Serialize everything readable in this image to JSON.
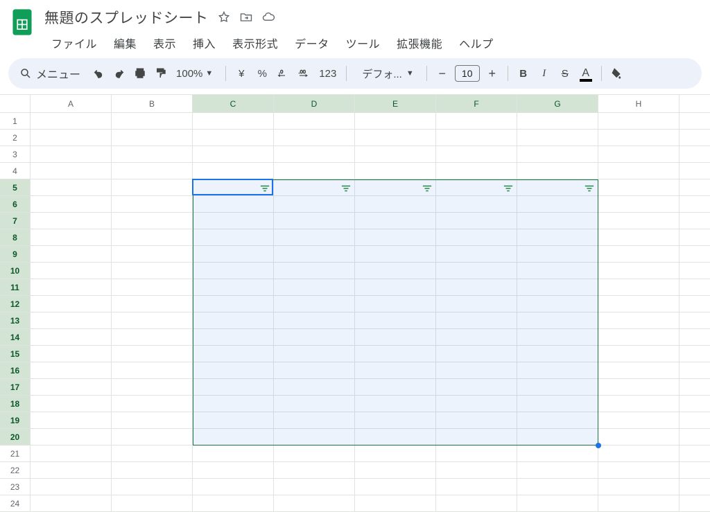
{
  "doc": {
    "title": "無題のスプレッドシート"
  },
  "menu": {
    "file": "ファイル",
    "edit": "編集",
    "view": "表示",
    "insert": "挿入",
    "format": "表示形式",
    "data": "データ",
    "tools": "ツール",
    "extensions": "拡張機能",
    "help": "ヘルプ"
  },
  "toolbar": {
    "menu_search": "メニュー",
    "zoom": "100%",
    "currency_symbol": "¥",
    "percent_symbol": "%",
    "decrease_dec": ".0",
    "increase_dec": ".00",
    "number_format": "123",
    "font_name": "デフォ...",
    "font_size": "10",
    "bold": "B",
    "italic": "I",
    "strike": "S",
    "text_color_letter": "A"
  },
  "columns": [
    "A",
    "B",
    "C",
    "D",
    "E",
    "F",
    "G",
    "H"
  ],
  "selected_cols": [
    "C",
    "D",
    "E",
    "F",
    "G"
  ],
  "rows": [
    1,
    2,
    3,
    4,
    5,
    6,
    7,
    8,
    9,
    10,
    11,
    12,
    13,
    14,
    15,
    16,
    17,
    18,
    19,
    20,
    21,
    22,
    23,
    24
  ],
  "selected_rows": [
    5,
    6,
    7,
    8,
    9,
    10,
    11,
    12,
    13,
    14,
    15,
    16,
    17,
    18,
    19,
    20
  ],
  "active_cell": "C5",
  "colors": {
    "sheets_green": "#0f9d58",
    "sel_header_bg": "#d3e3d4",
    "selection_border": "#1a7340",
    "active_border": "#1a73e8"
  }
}
